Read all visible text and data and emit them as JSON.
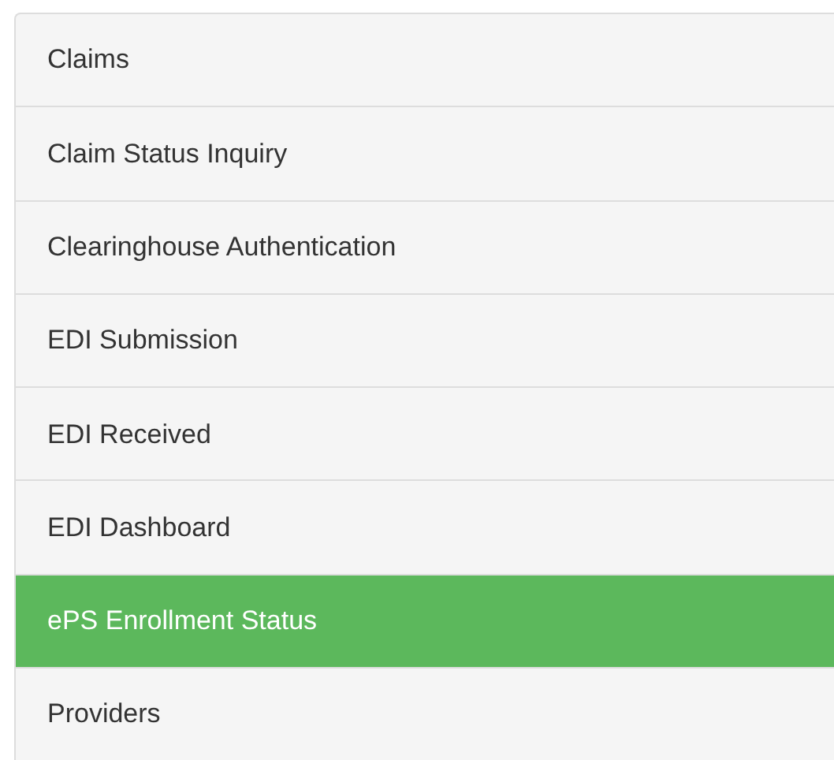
{
  "menu": {
    "items": [
      {
        "label": "Claims",
        "selected": false
      },
      {
        "label": "Claim Status Inquiry",
        "selected": false
      },
      {
        "label": "Clearinghouse Authentication",
        "selected": false
      },
      {
        "label": "EDI Submission",
        "selected": false
      },
      {
        "label": "EDI Received",
        "selected": false
      },
      {
        "label": "EDI Dashboard",
        "selected": false
      },
      {
        "label": "ePS Enrollment Status",
        "selected": true
      },
      {
        "label": "Providers",
        "selected": false
      }
    ]
  }
}
